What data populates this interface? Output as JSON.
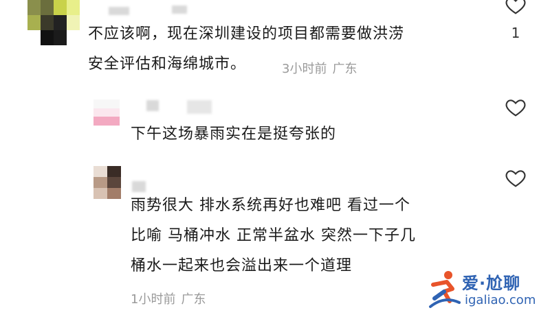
{
  "comments": [
    {
      "lines": [
        "不应该啊，现在深圳建设的项目都需要做洪涝",
        "安全评估和海绵城市。"
      ],
      "time": "3小时前",
      "location": "广东",
      "likes": "1"
    },
    {
      "lines": [
        "下午这场暴雨实在是挺夸张的"
      ]
    },
    {
      "lines": [
        "雨势很大 排水系统再好也难吧 看过一个",
        "比喻 马桶冲水 正常半盆水 突然一下子几",
        "桶水一起来也会溢出来一个道理"
      ],
      "time": "1小时前",
      "location": "广东"
    }
  ],
  "icons": {
    "like": "heart-outline-icon"
  },
  "watermark": {
    "brand": "爱·尬聊",
    "url": "igaliao.com",
    "color": "#2f63b3"
  }
}
